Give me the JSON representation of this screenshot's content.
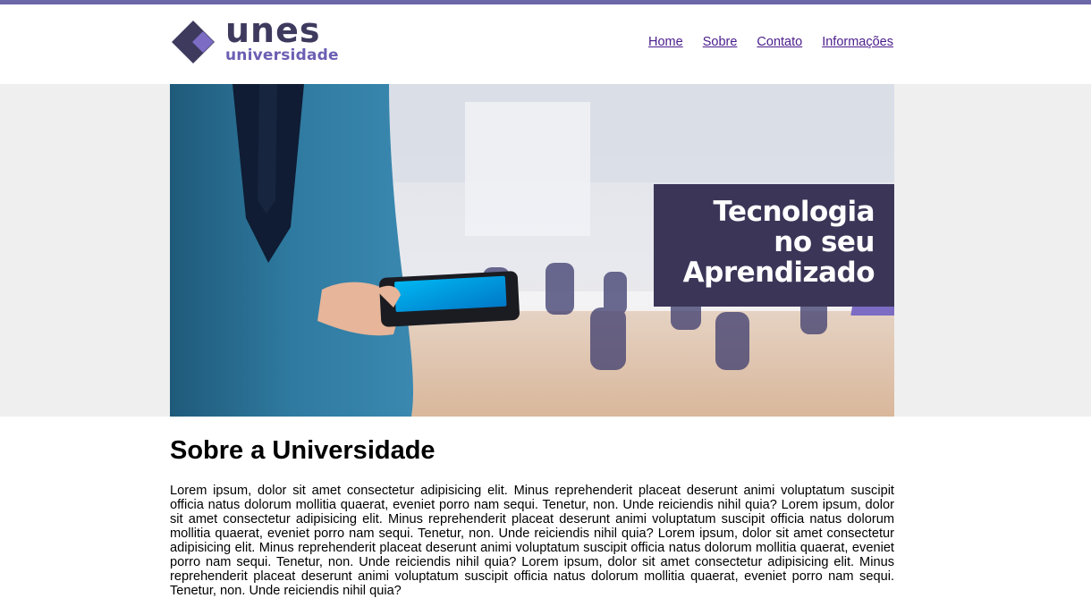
{
  "brand": {
    "name": "unes",
    "subtitle": "universidade",
    "colors": {
      "dark": "#3d3a5e",
      "accent": "#6b5fb3",
      "top_border": "#6b67a8"
    }
  },
  "nav": {
    "items": [
      {
        "label": "Home"
      },
      {
        "label": "Sobre"
      },
      {
        "label": "Contato"
      },
      {
        "label": "Informações"
      }
    ],
    "link_color": "#4a1d8c"
  },
  "hero": {
    "banner_lines": [
      "Tecnologia",
      "no seu",
      "Aprendizado"
    ],
    "banner_color": "#3b3658"
  },
  "main": {
    "heading": "Sobre a Universidade",
    "paragraph": "Lorem ipsum, dolor sit amet consectetur adipisicing elit. Minus reprehenderit placeat deserunt animi voluptatum suscipit officia natus dolorum mollitia quaerat, eveniet porro nam sequi. Tenetur, non. Unde reiciendis nihil quia? Lorem ipsum, dolor sit amet consectetur adipisicing elit. Minus reprehenderit placeat deserunt animi voluptatum suscipit officia natus dolorum mollitia quaerat, eveniet porro nam sequi. Tenetur, non. Unde reiciendis nihil quia? Lorem ipsum, dolor sit amet consectetur adipisicing elit. Minus reprehenderit placeat deserunt animi voluptatum suscipit officia natus dolorum mollitia quaerat, eveniet porro nam sequi. Tenetur, non. Unde reiciendis nihil quia? Lorem ipsum, dolor sit amet consectetur adipisicing elit. Minus reprehenderit placeat deserunt animi voluptatum suscipit officia natus dolorum mollitia quaerat, eveniet porro nam sequi. Tenetur, non. Unde reiciendis nihil quia?"
  }
}
